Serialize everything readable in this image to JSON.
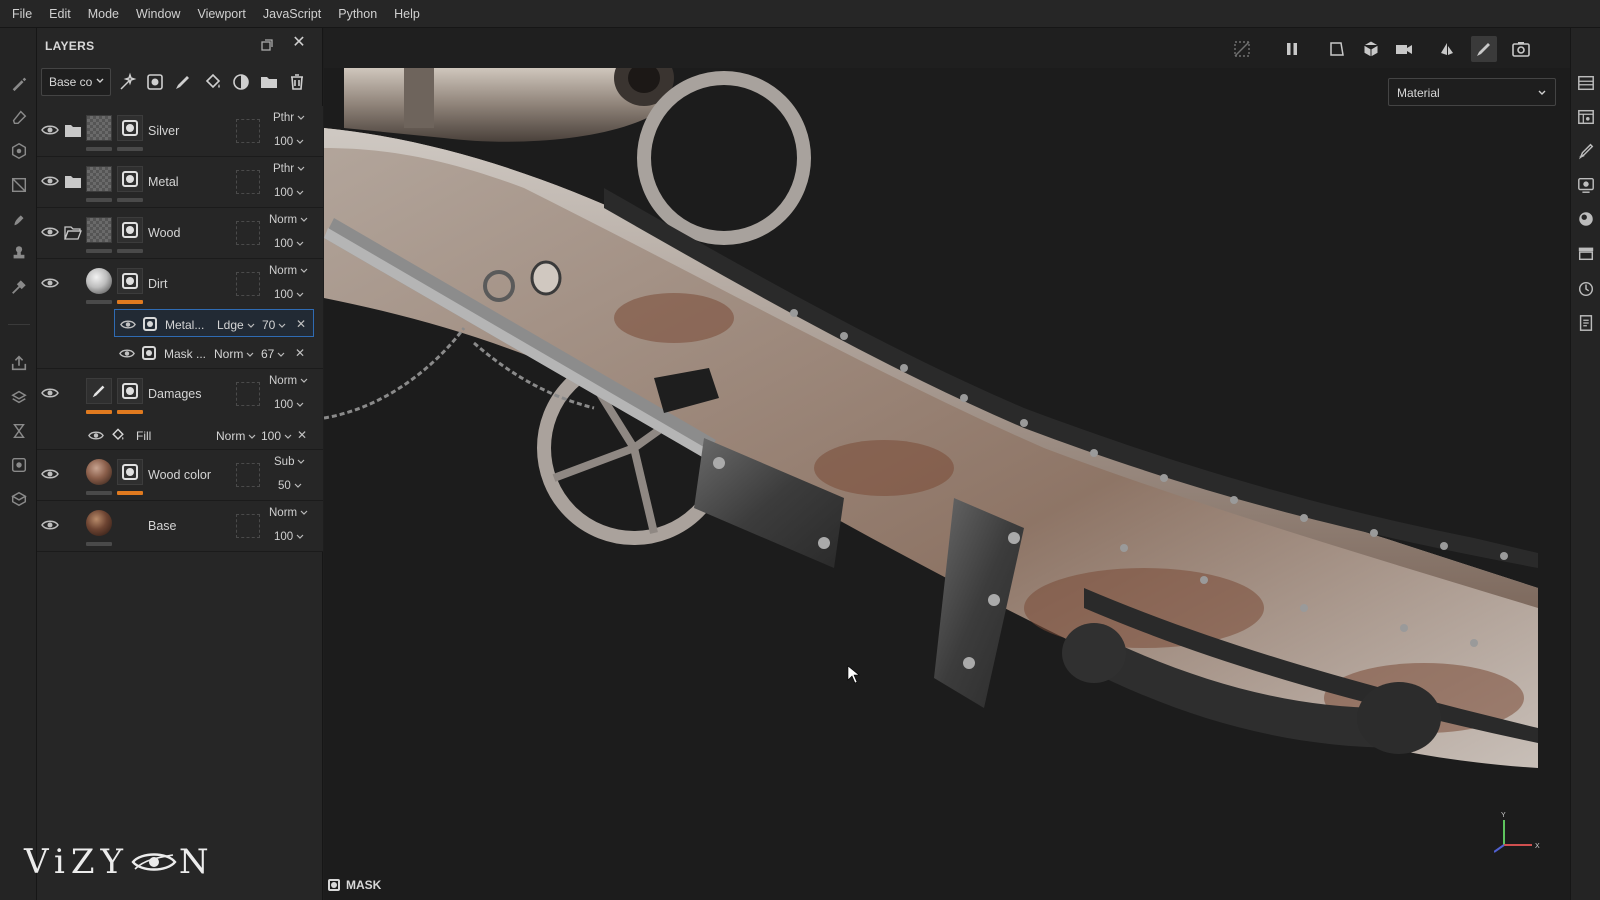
{
  "menu": [
    "File",
    "Edit",
    "Mode",
    "Window",
    "Viewport",
    "JavaScript",
    "Python",
    "Help"
  ],
  "layers_panel": {
    "title": "LAYERS",
    "channel_select": "Base co",
    "layers": [
      {
        "name": "Silver",
        "blend": "Pthr",
        "opacity": "100",
        "type": "folder",
        "visible": true
      },
      {
        "name": "Metal",
        "blend": "Pthr",
        "opacity": "100",
        "type": "folder",
        "visible": true
      },
      {
        "name": "Wood",
        "blend": "Norm",
        "opacity": "100",
        "type": "folder-open",
        "visible": true
      },
      {
        "name": "Dirt",
        "blend": "Norm",
        "opacity": "100",
        "type": "fill",
        "visible": true
      },
      {
        "name": "Damages",
        "blend": "Norm",
        "opacity": "100",
        "type": "paint",
        "visible": true
      },
      {
        "name": "Wood color",
        "blend": "Sub",
        "opacity": "50",
        "type": "fill",
        "visible": true
      },
      {
        "name": "Base",
        "blend": "Norm",
        "opacity": "100",
        "type": "fill",
        "visible": true
      }
    ],
    "dirt_effects": [
      {
        "name": "Metal...",
        "blend": "Ldge",
        "opacity": "70",
        "selected": true
      },
      {
        "name": "Mask ...",
        "blend": "Norm",
        "opacity": "67",
        "selected": false
      }
    ],
    "damages_effects": [
      {
        "name": "Fill",
        "blend": "Norm",
        "opacity": "100"
      }
    ]
  },
  "viewport": {
    "mode_select": "Material",
    "bottom_label": "MASK",
    "gizmo_y": "Y",
    "gizmo_x": "X"
  },
  "watermark": {
    "left": "ViZY",
    "right": "N"
  },
  "colors": {
    "accent_orange": "#e07a1f",
    "selection_blue": "#2f6bb3",
    "panel_bg": "#262626",
    "viewport_bg": "#1c1c1c"
  }
}
